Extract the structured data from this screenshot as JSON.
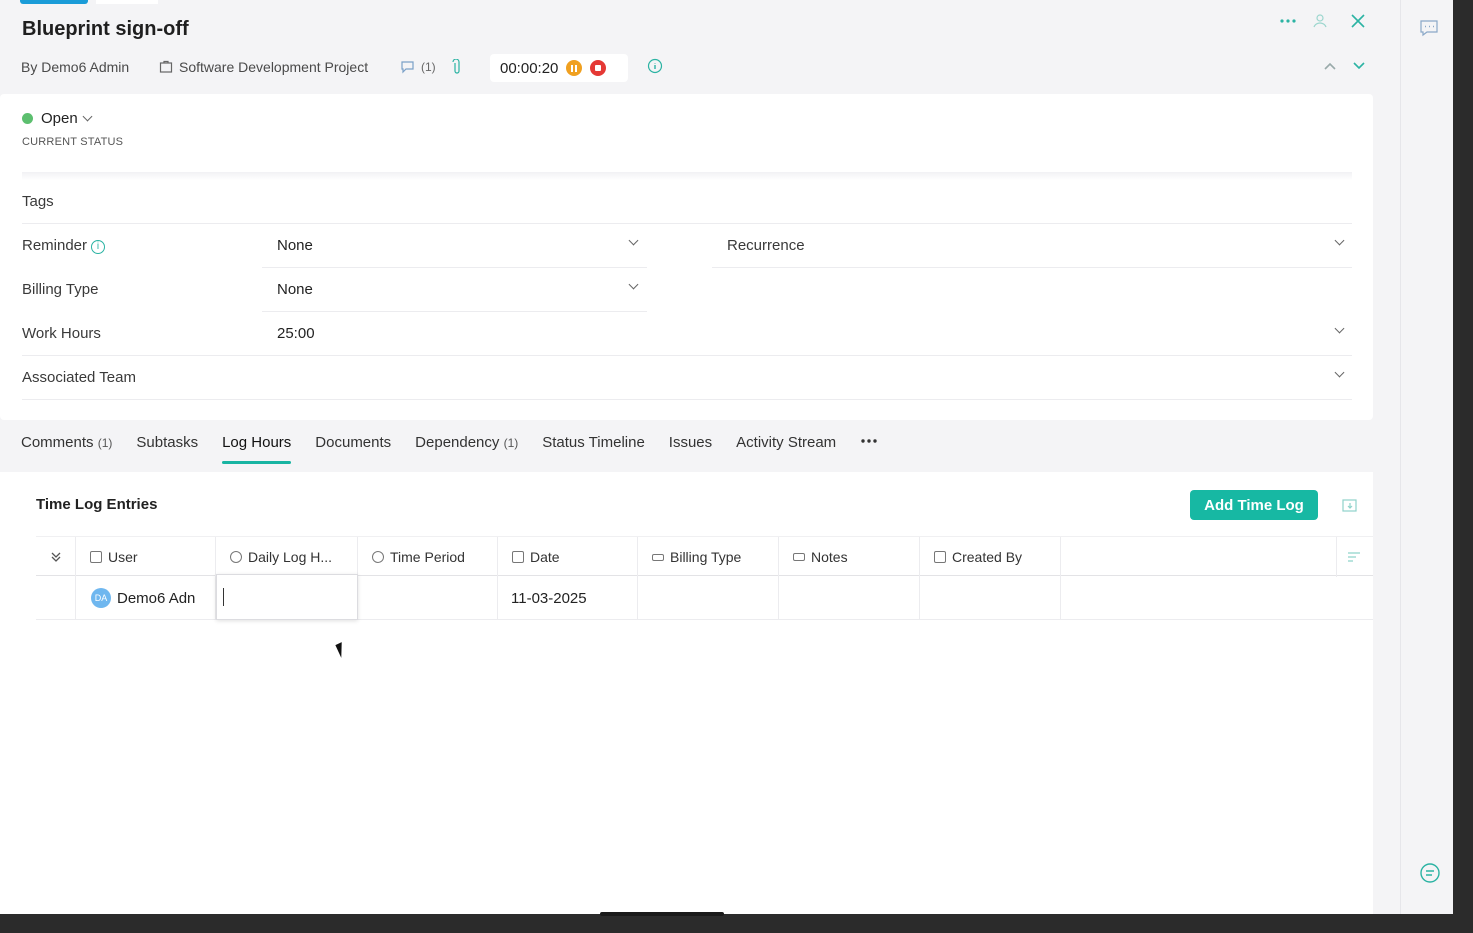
{
  "task": {
    "title": "Blueprint sign-off",
    "author": "By Demo6 Admin",
    "project": "Software Development Project",
    "comment_count": "(1)",
    "timer": "00:00:20"
  },
  "status": {
    "value": "Open",
    "caption": "CURRENT STATUS",
    "color": "#5cbf6f"
  },
  "fields": {
    "tags_label": "Tags",
    "reminder_label": "Reminder",
    "reminder_value": "None",
    "recurrence_label": "Recurrence",
    "billing_label": "Billing Type",
    "billing_value": "None",
    "work_hours_label": "Work Hours",
    "work_hours_value": "25:00",
    "team_label": "Associated Team"
  },
  "tabs": [
    {
      "label": "Comments",
      "count": "(1)"
    },
    {
      "label": "Subtasks",
      "count": ""
    },
    {
      "label": "Log Hours",
      "count": ""
    },
    {
      "label": "Documents",
      "count": ""
    },
    {
      "label": "Dependency",
      "count": "(1)"
    },
    {
      "label": "Status Timeline",
      "count": ""
    },
    {
      "label": "Issues",
      "count": ""
    },
    {
      "label": "Activity Stream",
      "count": ""
    }
  ],
  "log": {
    "title": "Time Log Entries",
    "add_button": "Add Time Log",
    "columns": [
      "User",
      "Daily Log H...",
      "Time Period",
      "Date",
      "Billing Type",
      "Notes",
      "Created By"
    ],
    "rows": [
      {
        "avatar": "DA",
        "user": "Demo6 Adn",
        "daily_log": "",
        "time_period": "",
        "date": "11-03-2025",
        "billing_type": "",
        "notes": "",
        "created_by": ""
      }
    ]
  },
  "colors": {
    "accent": "#17b8a3",
    "link_blue": "#1a9cd8",
    "pause": "#f0a020",
    "stop": "#e53935"
  }
}
